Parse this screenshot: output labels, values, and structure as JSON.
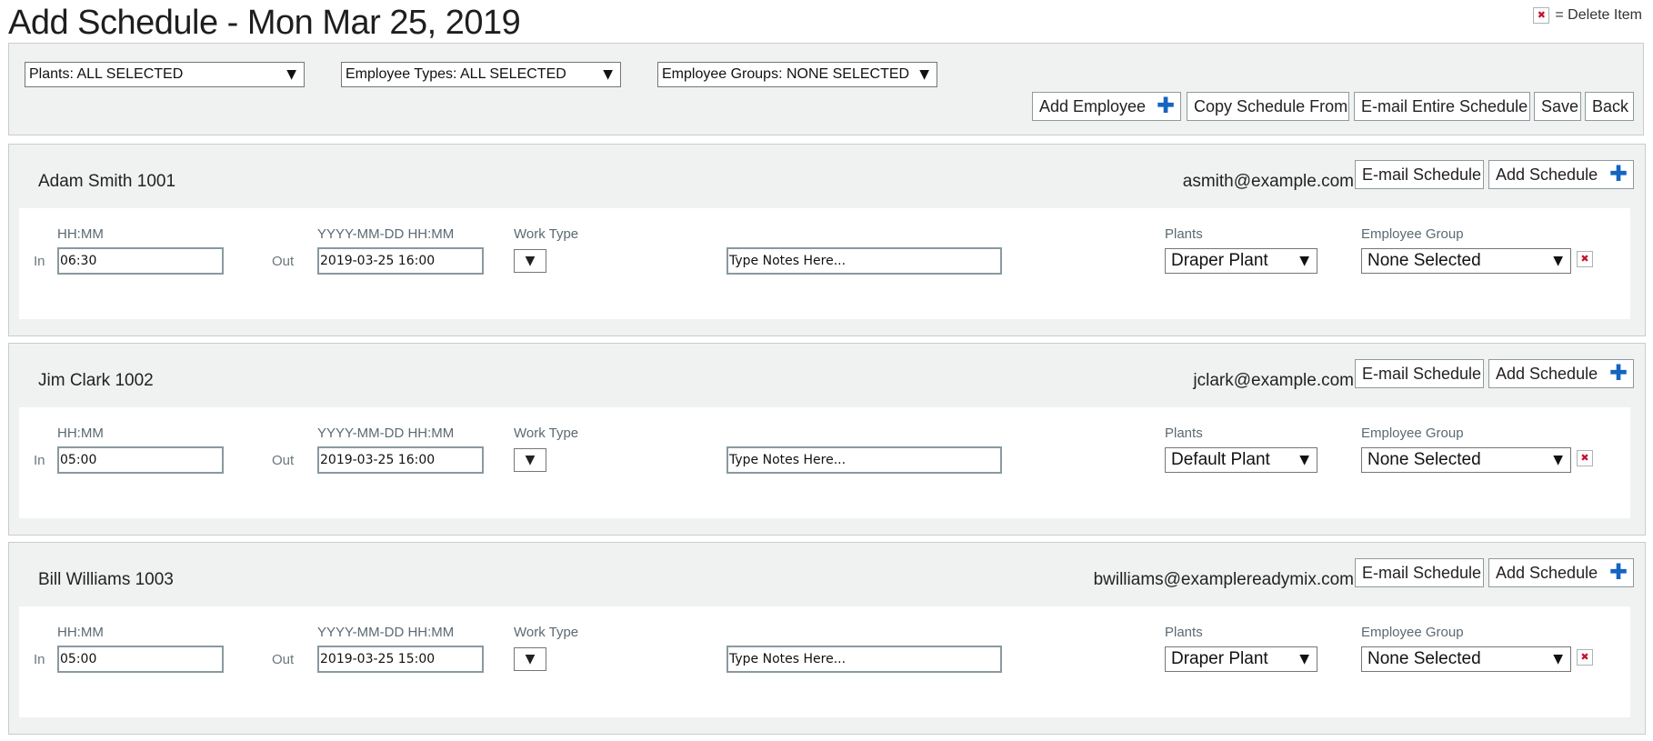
{
  "page": {
    "title": "Add Schedule - Mon Mar 25, 2019",
    "legend": "= Delete Item",
    "delete_icon": "delete-x-icon",
    "delete_color": "#c8102e",
    "accent": "#1565c0"
  },
  "toolbar": {
    "filters": {
      "plants": "Plants: ALL SELECTED",
      "employee_types": "Employee Types: ALL SELECTED",
      "employee_groups": "Employee Groups: NONE SELECTED"
    },
    "buttons": {
      "add_employee": "Add Employee",
      "copy_schedule": "Copy Schedule From",
      "email_all": "E-mail Entire Schedule",
      "save": "Save",
      "back": "Back"
    }
  },
  "labels": {
    "in_hint": "HH:MM",
    "out_hint": "YYYY-MM-DD HH:MM",
    "work_type": "Work Type",
    "plants": "Plants",
    "employee_group": "Employee Group",
    "in": "In",
    "out": "Out",
    "email_schedule": "E-mail Schedule",
    "add_schedule": "Add Schedule",
    "notes_placeholder": "Type Notes Here..."
  },
  "employees": [
    {
      "name": "Adam Smith 1001",
      "email": "asmith@example.com",
      "in": "06:30",
      "out": "2019-03-25 16:00",
      "plant": "Draper Plant",
      "group": "None Selected"
    },
    {
      "name": "Jim Clark 1002",
      "email": "jclark@example.com",
      "in": "05:00",
      "out": "2019-03-25 16:00",
      "plant": "Default Plant",
      "group": "None Selected"
    },
    {
      "name": "Bill Williams 1003",
      "email": "bwilliams@examplereadymix.com",
      "in": "05:00",
      "out": "2019-03-25 15:00",
      "plant": "Draper Plant",
      "group": "None Selected"
    }
  ]
}
